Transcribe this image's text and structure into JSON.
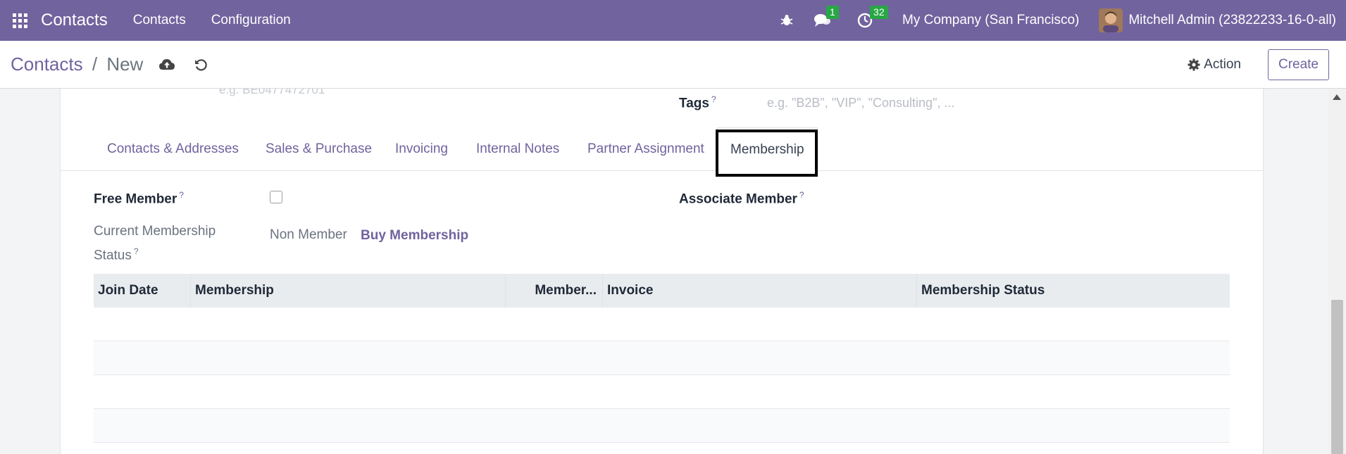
{
  "navbar": {
    "brand": "Contacts",
    "menu": [
      "Contacts",
      "Configuration"
    ],
    "messages_badge": "1",
    "activities_badge": "32",
    "company": "My Company (San Francisco)",
    "user": "Mitchell Admin (23822233-16-0-all)"
  },
  "control": {
    "breadcrumb_parent": "Contacts",
    "breadcrumb_separator": "/",
    "breadcrumb_current": "New",
    "action_label": "Action",
    "create_label": "Create"
  },
  "form": {
    "ghost_text": "e.g. BE0477472701",
    "tags_label": "Tags",
    "tags_placeholder": "e.g. \"B2B\", \"VIP\", \"Consulting\", ...",
    "help_mark": "?"
  },
  "tabs": [
    {
      "label": "Contacts & Addresses"
    },
    {
      "label": "Sales & Purchase"
    },
    {
      "label": "Invoicing"
    },
    {
      "label": "Internal Notes"
    },
    {
      "label": "Partner Assignment"
    },
    {
      "label": "Membership",
      "active": true
    }
  ],
  "membership": {
    "free_member_label": "Free Member",
    "associate_member_label": "Associate Member",
    "status_label": "Current Membership Status",
    "status_value": "Non Member",
    "buy_label": "Buy Membership",
    "columns": [
      "Join Date",
      "Membership",
      "Member...",
      "Invoice",
      "Membership Status"
    ]
  },
  "colors": {
    "brand": "#71639e",
    "badge": "#28a745"
  }
}
